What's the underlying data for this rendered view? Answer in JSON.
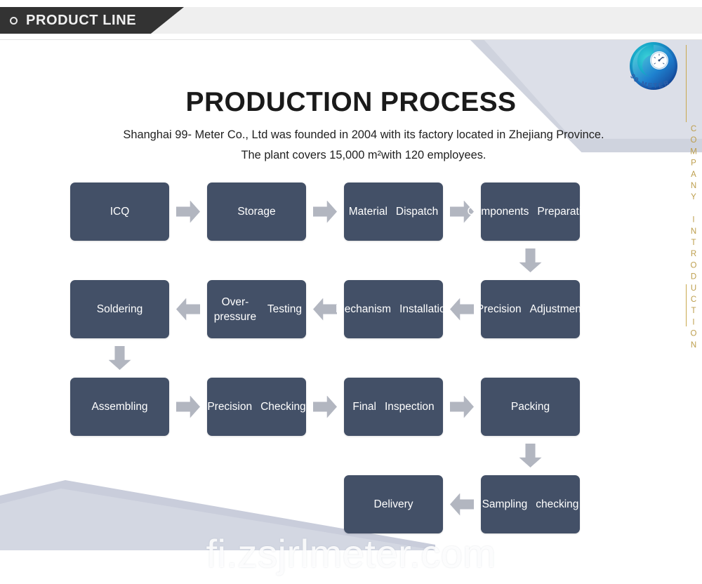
{
  "header": {
    "tab_label": "PRODUCT LINE",
    "dot_icon": "circle-icon"
  },
  "brand": {
    "logo_name": "99-meter-logo",
    "logo_text": "99 METER",
    "vertical_rail_text": "COMPANY INTRODUCTION",
    "accent_gold": "#bd9e4c"
  },
  "page": {
    "title": "PRODUCTION PROCESS",
    "subtitle": "Shanghai 99- Meter Co., Ltd was founded in 2004 with its factory located in Zhejiang Province. The plant covers 15,000 m²with 120 employees."
  },
  "colors": {
    "box_fill": "#435067",
    "arrow_fill": "#b2b6c0",
    "header_dark": "#333333",
    "header_light": "#efefef",
    "decor_gray": "#cfd3de"
  },
  "flow": {
    "rows": [
      {
        "direction": "right",
        "steps": [
          {
            "label": "ICQ",
            "lines": [
              "ICQ"
            ]
          },
          {
            "label": "Storage",
            "lines": [
              "Storage"
            ]
          },
          {
            "label": "Material Dispatch",
            "lines": [
              "Material",
              "Dispatch"
            ]
          },
          {
            "label": "Components Preparation",
            "lines": [
              "Components",
              "Preparation"
            ]
          }
        ]
      },
      {
        "direction": "left",
        "steps": [
          {
            "label": "Soldering",
            "lines": [
              "Soldering"
            ]
          },
          {
            "label": "Over-pressure Testing",
            "lines": [
              "Over-pressure",
              "Testing"
            ]
          },
          {
            "label": "Mechanism Installation",
            "lines": [
              "Mechanism",
              "Installation"
            ]
          },
          {
            "label": "Precision Adjustment",
            "lines": [
              "Precision",
              "Adjustment"
            ]
          }
        ]
      },
      {
        "direction": "right",
        "steps": [
          {
            "label": "Assembling",
            "lines": [
              "Assembling"
            ]
          },
          {
            "label": "Precision Checking",
            "lines": [
              "Precision",
              "Checking"
            ]
          },
          {
            "label": "Final Inspection",
            "lines": [
              "Final",
              "Inspection"
            ]
          },
          {
            "label": "Packing",
            "lines": [
              "Packing"
            ]
          }
        ]
      },
      {
        "direction": "left",
        "steps": [
          {
            "label": "Delivery",
            "lines": [
              "Delivery"
            ]
          },
          {
            "label": "Sampling checking",
            "lines": [
              "Sampling",
              "checking"
            ]
          }
        ]
      }
    ],
    "connectors": [
      {
        "name": "arrow-down-components-to-precision"
      },
      {
        "name": "arrow-down-soldering-to-assembling"
      },
      {
        "name": "arrow-down-packing-to-sampling"
      }
    ]
  },
  "watermark": {
    "text": "fi.zsjrlmeter.com"
  }
}
